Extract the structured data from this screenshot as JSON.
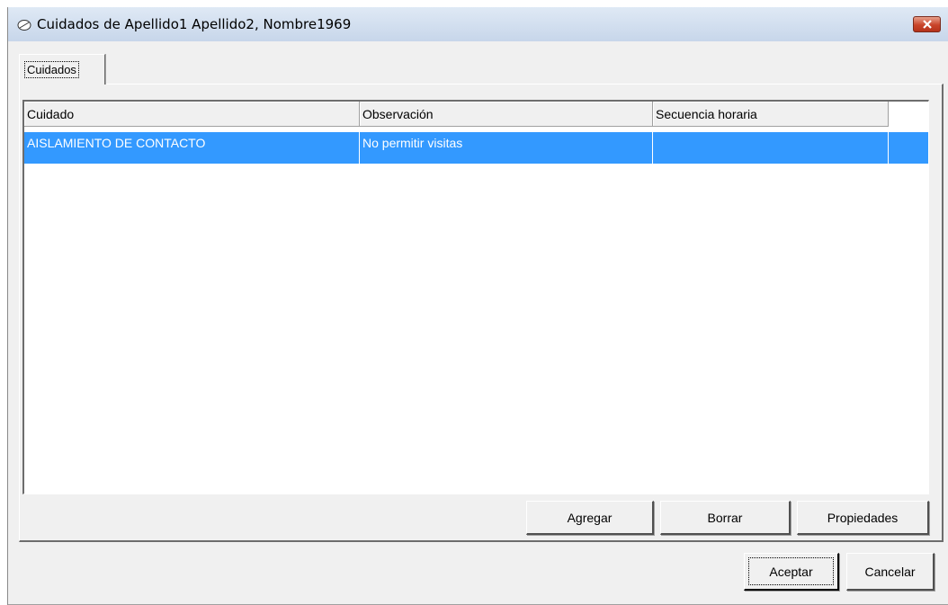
{
  "window": {
    "title": "Cuidados de Apellido1 Apellido2, Nombre1969",
    "icon": "pill-icon",
    "close_icon": "close-icon"
  },
  "tabs": [
    {
      "label": "Cuidados",
      "selected": true
    }
  ],
  "grid": {
    "columns": [
      "Cuidado",
      "Observación",
      "Secuencia horaria"
    ],
    "rows": [
      {
        "selected": true,
        "cells": [
          "AISLAMIENTO DE CONTACTO",
          "No permitir visitas",
          ""
        ]
      }
    ]
  },
  "panel_buttons": {
    "add": "Agregar",
    "delete": "Borrar",
    "properties": "Propiedades"
  },
  "dialog_buttons": {
    "accept": "Aceptar",
    "cancel": "Cancelar"
  },
  "colors": {
    "selection": "#3399ff",
    "close_button": "#c9452a"
  }
}
